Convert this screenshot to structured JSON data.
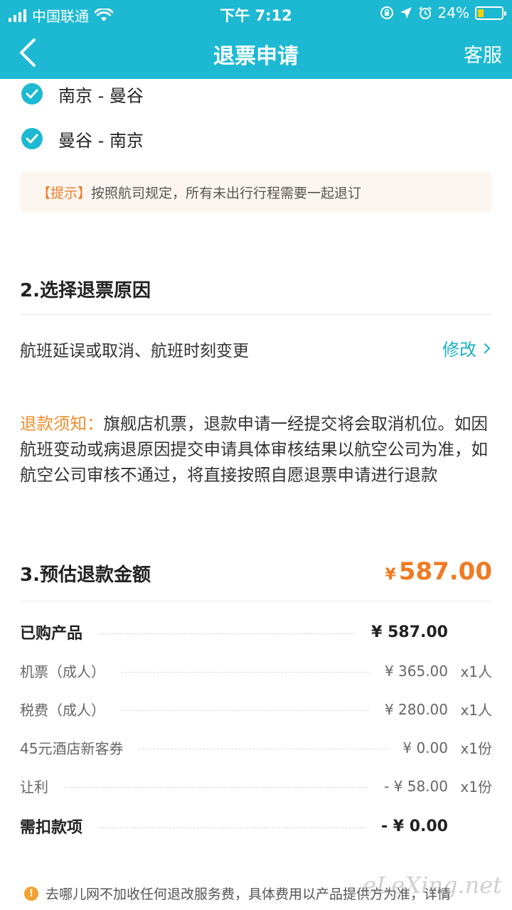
{
  "status_bar": {
    "carrier": "中国联通",
    "time": "下午 7:12",
    "battery": "24%",
    "battery_level": 0.24
  },
  "nav": {
    "title": "退票申请",
    "service": "客服"
  },
  "routes": [
    {
      "label": "南京 - 曼谷",
      "checked": true
    },
    {
      "label": "曼谷 - 南京",
      "checked": true
    }
  ],
  "tip": {
    "label": "【提示】",
    "text": "按照航司规定，所有未出行行程需要一起退订"
  },
  "section2": {
    "title": "2.选择退票原因",
    "reason": "航班延误或取消、航班时刻变更",
    "modify": "修改"
  },
  "notice": {
    "label": "退款须知：",
    "text": "旗舰店机票，退款申请一经提交将会取消机位。如因航班变动或病退原因提交申请具体审核结果以航空公司为准，如航空公司审核不通过，将直接按照自愿退票申请进行退款"
  },
  "section3": {
    "title": "3.预估退款金额",
    "currency": "¥",
    "total": "587.00"
  },
  "fees": [
    {
      "label": "已购产品",
      "amount": "¥ 587.00",
      "qty": "",
      "strong": true
    },
    {
      "label": "机票（成人）",
      "amount": "¥ 365.00",
      "qty": "x1人",
      "strong": false
    },
    {
      "label": "税费（成人）",
      "amount": "¥ 280.00",
      "qty": "x1人",
      "strong": false
    },
    {
      "label": "45元酒店新客券",
      "amount": "¥ 0.00",
      "qty": "x1份",
      "strong": false
    },
    {
      "label": "让利",
      "amount": "- ¥ 58.00",
      "qty": "x1份",
      "strong": false
    },
    {
      "label": "需扣款项",
      "amount": "- ¥ 0.00",
      "qty": "",
      "strong": true
    }
  ],
  "footer": {
    "text": "去哪儿网不加收任何退改服务费，具体费用以产品提供方为准，详情"
  },
  "watermark": "eLeXing.net",
  "colors": {
    "brand": "#1db9d3",
    "accent_orange": "#f07a23",
    "link": "#1ab0c9"
  }
}
